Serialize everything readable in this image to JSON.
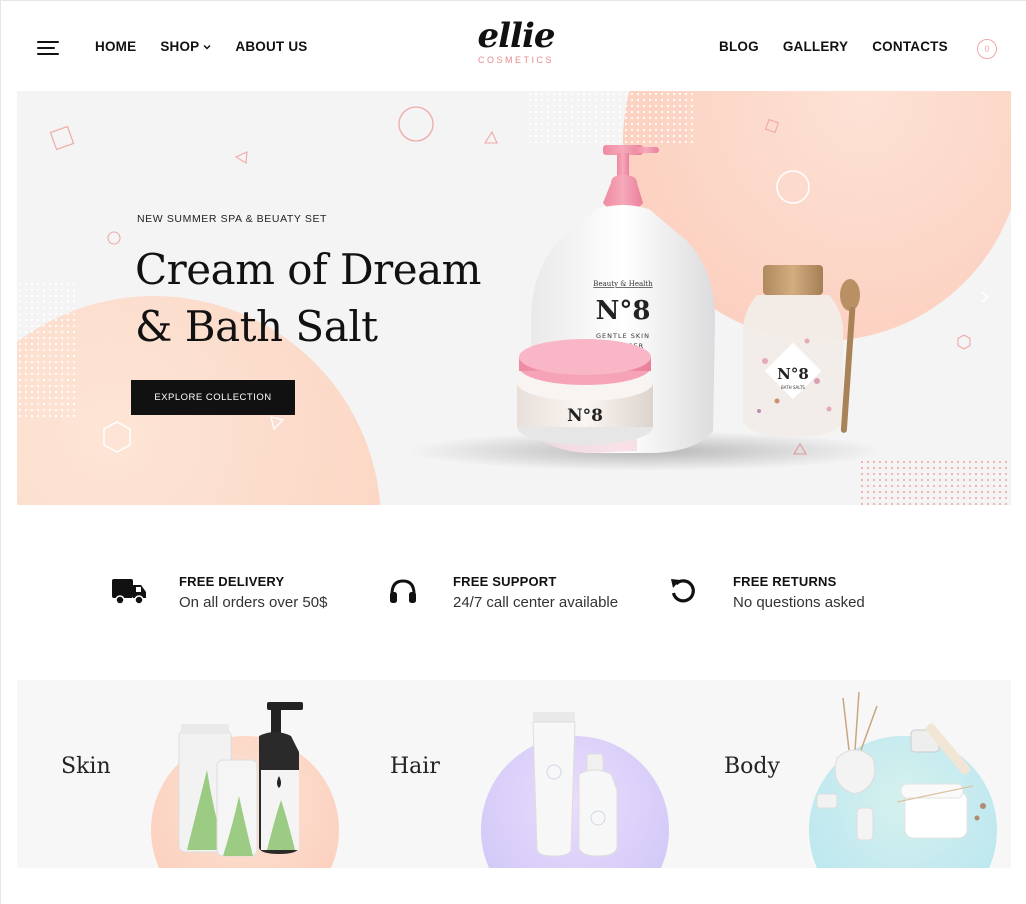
{
  "header": {
    "nav_left": [
      {
        "label": "HOME"
      },
      {
        "label": "SHOP"
      },
      {
        "label": "ABOUT US"
      }
    ],
    "nav_right": [
      {
        "label": "BLOG"
      },
      {
        "label": "GALLERY"
      },
      {
        "label": "CONTACTS"
      }
    ],
    "logo": {
      "script": "ellie",
      "sub": "COSMETICS"
    },
    "cart_count": "0"
  },
  "hero": {
    "kicker": "NEW SUMMER SPA & BEUATY SET",
    "title_line1": "Cream of Dream",
    "title_line2": "& Bath Salt",
    "button_label": "EXPLORE COLLECTION",
    "bottle_brand": "Beauty & Health",
    "bottle_no": "N°8",
    "bottle_desc1": "GENTLE SKIN",
    "bottle_desc2": "CLEANSER",
    "jar_no": "N°8",
    "salt_no": "N°8",
    "salt_desc": "BATH SALTS"
  },
  "features": [
    {
      "title": "FREE DELIVERY",
      "sub": "On all orders over 50$",
      "icon": "truck-icon"
    },
    {
      "title": "FREE SUPPORT",
      "sub": "24/7 call center available",
      "icon": "headphones-icon"
    },
    {
      "title": "FREE RETURNS",
      "sub": "No questions asked",
      "icon": "return-arrow-icon"
    }
  ],
  "categories": [
    {
      "label": "Skin"
    },
    {
      "label": "Hair"
    },
    {
      "label": "Body"
    }
  ],
  "colors": {
    "accent_pink": "#f0a9a6",
    "peach": "#fbcab9",
    "dark": "#111111"
  }
}
